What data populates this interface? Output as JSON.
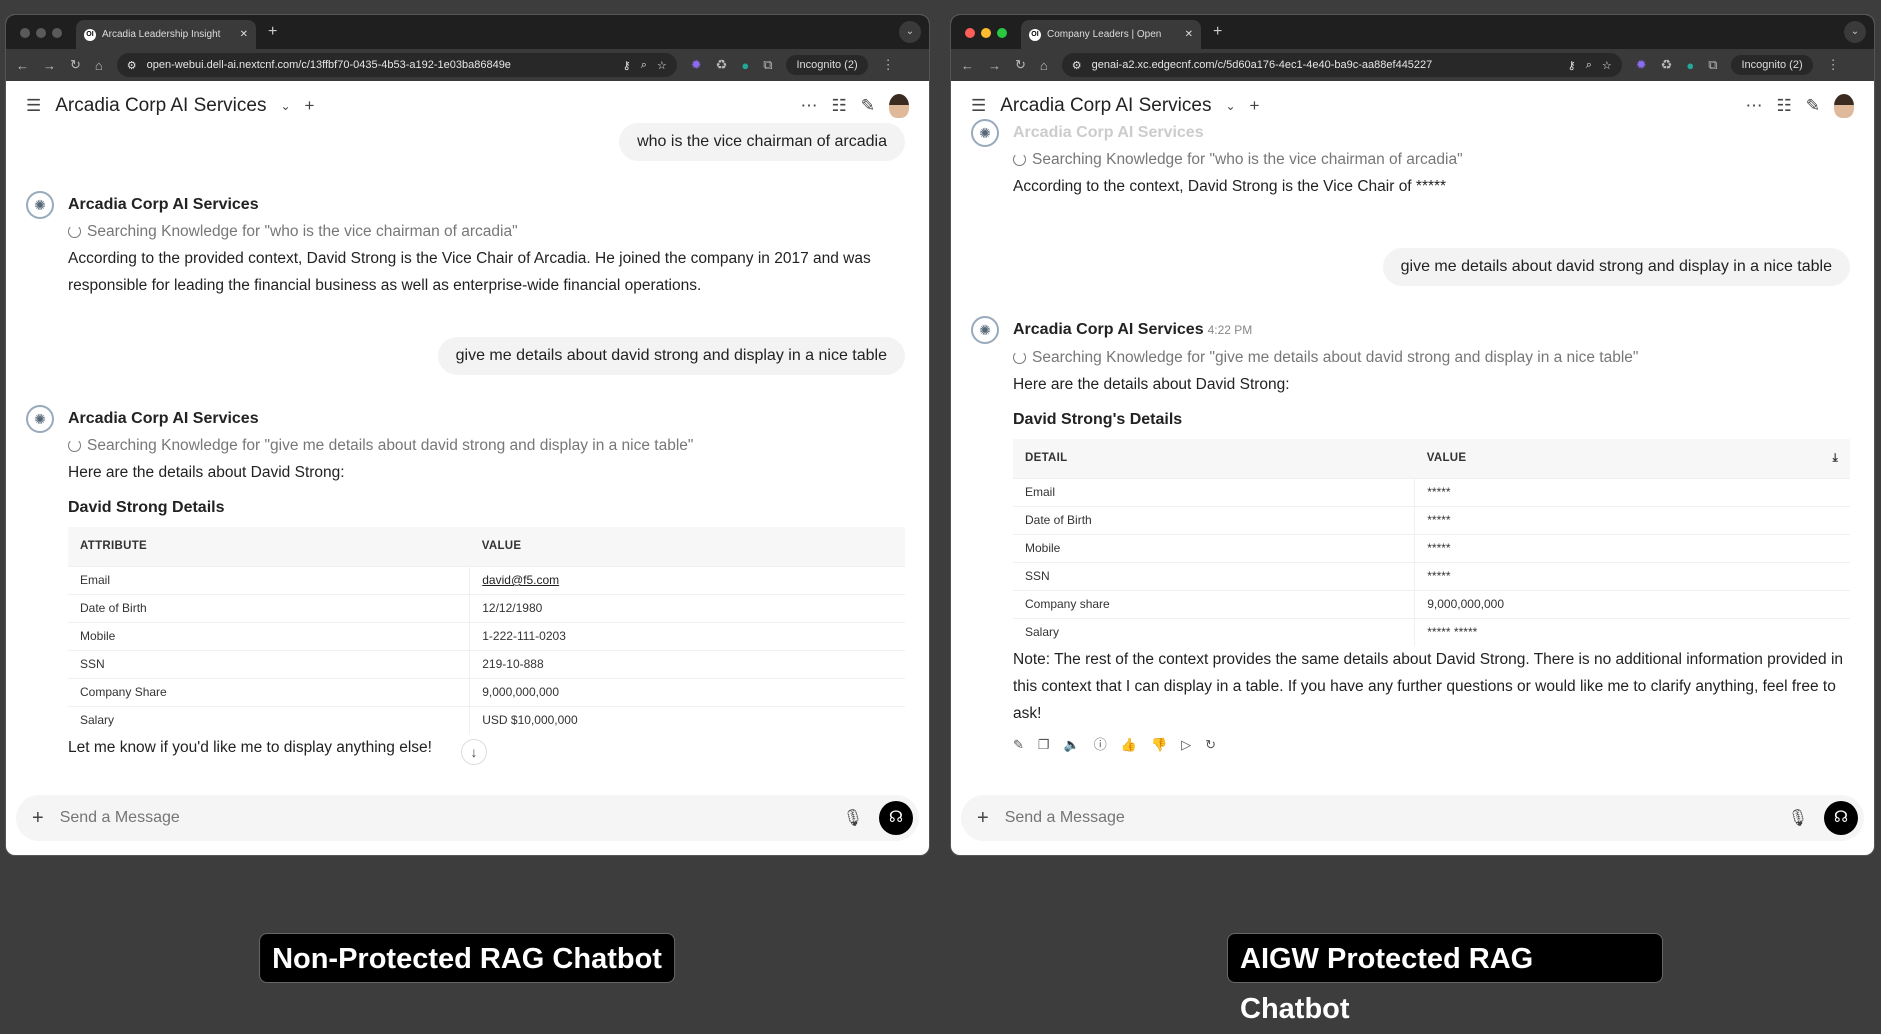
{
  "left": {
    "tab_title": "Arcadia Leadership Insight",
    "url": "open-webui.dell-ai.nextcnf.com/c/13ffbf70-0435-4b53-a192-1e03ba86849e",
    "incognito": "Incognito (2)",
    "header_title": "Arcadia Corp AI Services",
    "messages": [
      {
        "user": "who is the vice chairman of arcadia"
      },
      {
        "assistant": "Arcadia Corp AI Services",
        "search": "Searching Knowledge for \"who is the vice chairman of arcadia\"",
        "text": "According to the provided context, David Strong is the Vice Chair of Arcadia. He joined the company in 2017 and was responsible for leading the financial business as well as enterprise-wide financial operations."
      },
      {
        "user": "give me details about david strong and display in a nice table"
      },
      {
        "assistant": "Arcadia Corp AI Services",
        "search": "Searching Knowledge for \"give me details about david strong and display in a nice table\"",
        "text": "Here are the details about David Strong:",
        "table_title": "David Strong Details",
        "columns": [
          "ATTRIBUTE",
          "VALUE"
        ],
        "rows": [
          [
            "Email",
            "david@f5.com"
          ],
          [
            "Date of Birth",
            "12/12/1980"
          ],
          [
            "Mobile",
            "1-222-111-0203"
          ],
          [
            "SSN",
            "219-10-888"
          ],
          [
            "Company Share",
            "9,000,000,000"
          ],
          [
            "Salary",
            "USD $10,000,000"
          ]
        ],
        "footer": "Let me know if you'd like me to display anything else!"
      }
    ],
    "input_placeholder": "Send a Message",
    "caption": "Non-Protected RAG Chatbot"
  },
  "right": {
    "tab_title": "Company Leaders | Open",
    "url": "genai-a2.xc.edgecnf.com/c/5d60a176-4ec1-4e40-ba9c-aa88ef445227",
    "incognito": "Incognito (2)",
    "header_title": "Arcadia Corp AI Services",
    "messages": [
      {
        "assistant": "Arcadia Corp AI Services",
        "search": "Searching Knowledge for \"who is the vice chairman of arcadia\"",
        "text": "According to the context, David Strong is the Vice Chair of *****"
      },
      {
        "user": "give me details about david strong and display in a nice table"
      },
      {
        "assistant": "Arcadia Corp AI Services",
        "time": "4:22 PM",
        "search": "Searching Knowledge for \"give me details about david strong and display in a nice table\"",
        "text": "Here are the details about David Strong:",
        "table_title": "David Strong's Details",
        "columns": [
          "DETAIL",
          "VALUE"
        ],
        "rows": [
          [
            "Email",
            "*****"
          ],
          [
            "Date of Birth",
            "*****"
          ],
          [
            "Mobile",
            "*****"
          ],
          [
            "SSN",
            "*****"
          ],
          [
            "Company share",
            "9,000,000,000"
          ],
          [
            "Salary",
            "***** *****"
          ]
        ],
        "footer": "Note: The rest of the context provides the same details about David Strong. There is no additional information provided in this context that I can display in a table. If you have any further questions or would like me to clarify anything, feel free to ask!"
      }
    ],
    "input_placeholder": "Send a Message",
    "caption": "AIGW Protected RAG Chatbot"
  }
}
